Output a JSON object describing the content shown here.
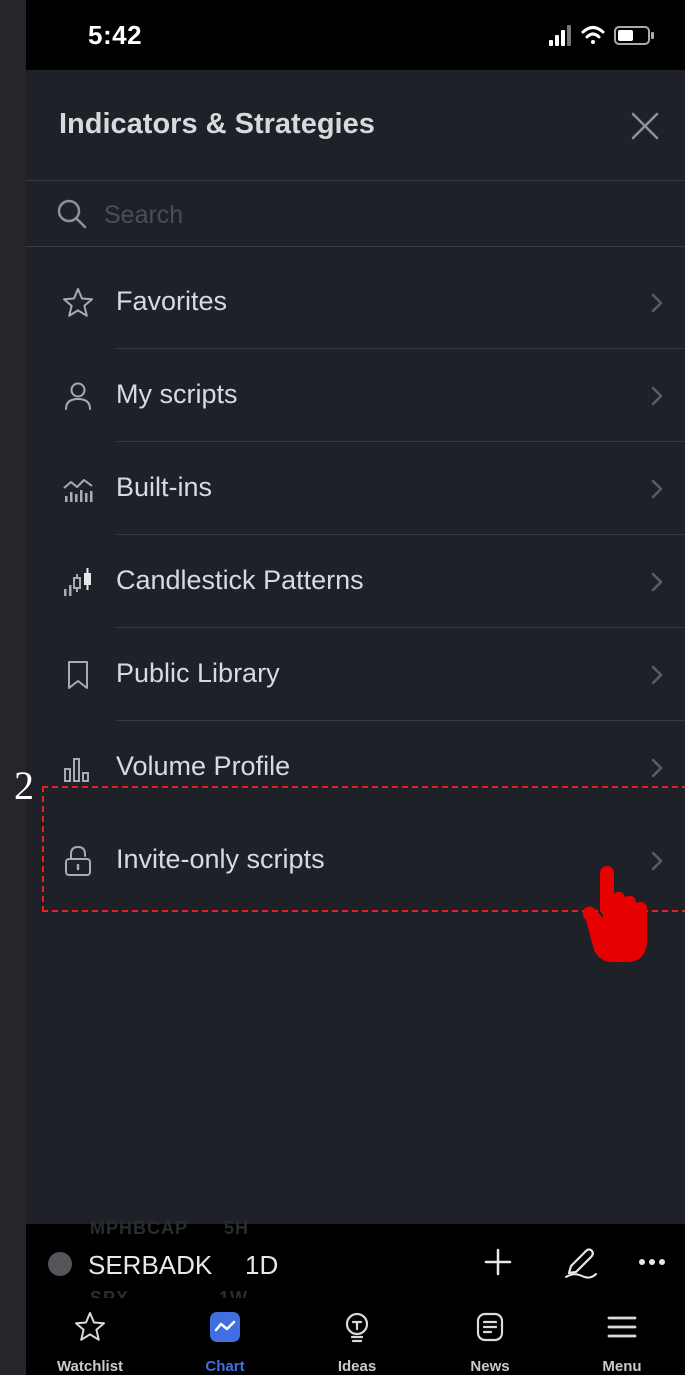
{
  "status_bar": {
    "time": "5:42"
  },
  "panel": {
    "title": "Indicators & Strategies",
    "search_placeholder": "Search",
    "items": [
      {
        "label": "Favorites",
        "icon": "star-icon"
      },
      {
        "label": "My scripts",
        "icon": "user-icon"
      },
      {
        "label": "Built-ins",
        "icon": "chart-icon"
      },
      {
        "label": "Candlestick Patterns",
        "icon": "candlestick-icon"
      },
      {
        "label": "Public Library",
        "icon": "bookmark-icon"
      },
      {
        "label": "Volume Profile",
        "icon": "volume-profile-icon"
      },
      {
        "label": "Invite-only scripts",
        "icon": "lock-icon"
      }
    ]
  },
  "annotation": {
    "step": "2",
    "highlight_color": "#e52222"
  },
  "ticker_bar": {
    "symbol": "SERBADK",
    "timeframe": "1D"
  },
  "tab_bar": {
    "tabs": [
      {
        "label": "Watchlist",
        "icon": "star-icon"
      },
      {
        "label": "Chart",
        "icon": "chart-icon",
        "active": true
      },
      {
        "label": "Ideas",
        "icon": "lightbulb-icon"
      },
      {
        "label": "News",
        "icon": "news-icon"
      },
      {
        "label": "Menu",
        "icon": "menu-icon"
      }
    ]
  },
  "colors": {
    "accent": "#3f6fe0",
    "background": "#1f2128"
  }
}
